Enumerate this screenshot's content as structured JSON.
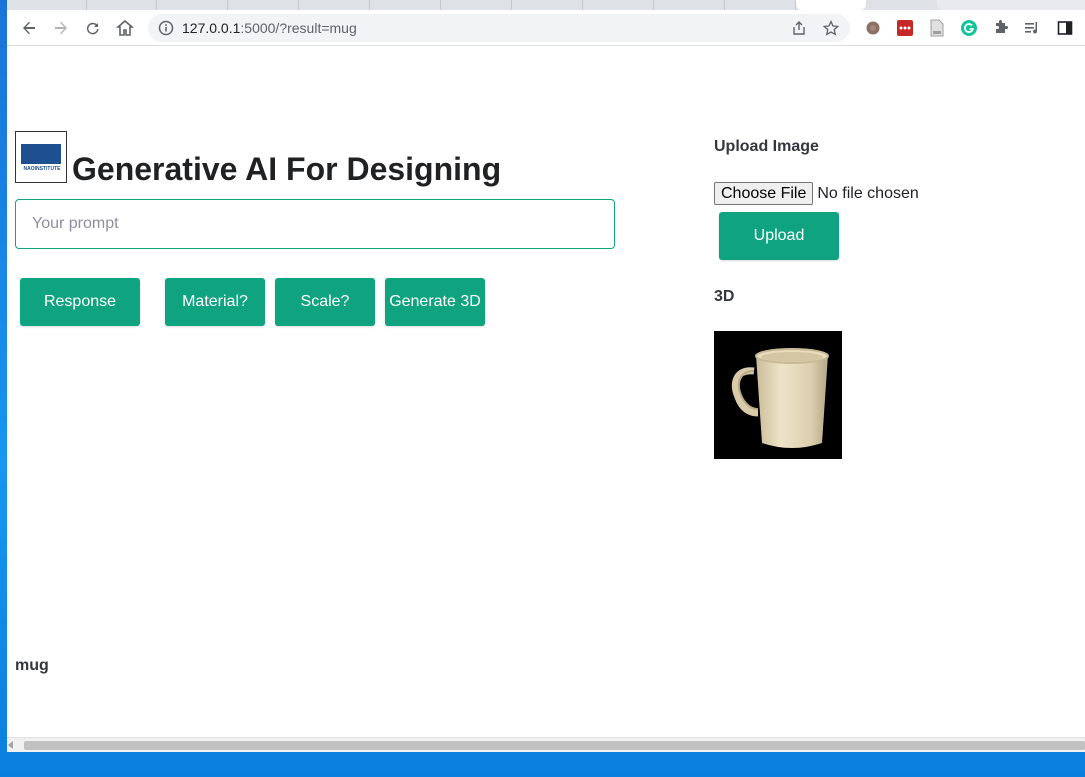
{
  "browser": {
    "url_host": "127.0.0.1",
    "url_rest": ":5000/?result=mug",
    "icons": [
      "back-icon",
      "forward-icon",
      "reload-icon",
      "home-icon",
      "info-icon",
      "share-icon",
      "star-icon",
      "extensions-icon",
      "media-icon",
      "sidepanel-icon"
    ]
  },
  "header": {
    "logo_text": "NAOINSTITUTE",
    "title": "Generative AI For Designing"
  },
  "prompt": {
    "placeholder": "Your prompt",
    "value": ""
  },
  "buttons": {
    "response": "Response",
    "material": "Material?",
    "scale": "Scale?",
    "generate_3d": "Generate 3D"
  },
  "upload": {
    "label": "Upload Image",
    "choose_file": "Choose File",
    "file_status": "No file chosen",
    "upload_button": "Upload"
  },
  "preview": {
    "label": "3D"
  },
  "result": {
    "text": "mug"
  },
  "colors": {
    "accent": "#10a37f",
    "text_dark": "#353740"
  }
}
